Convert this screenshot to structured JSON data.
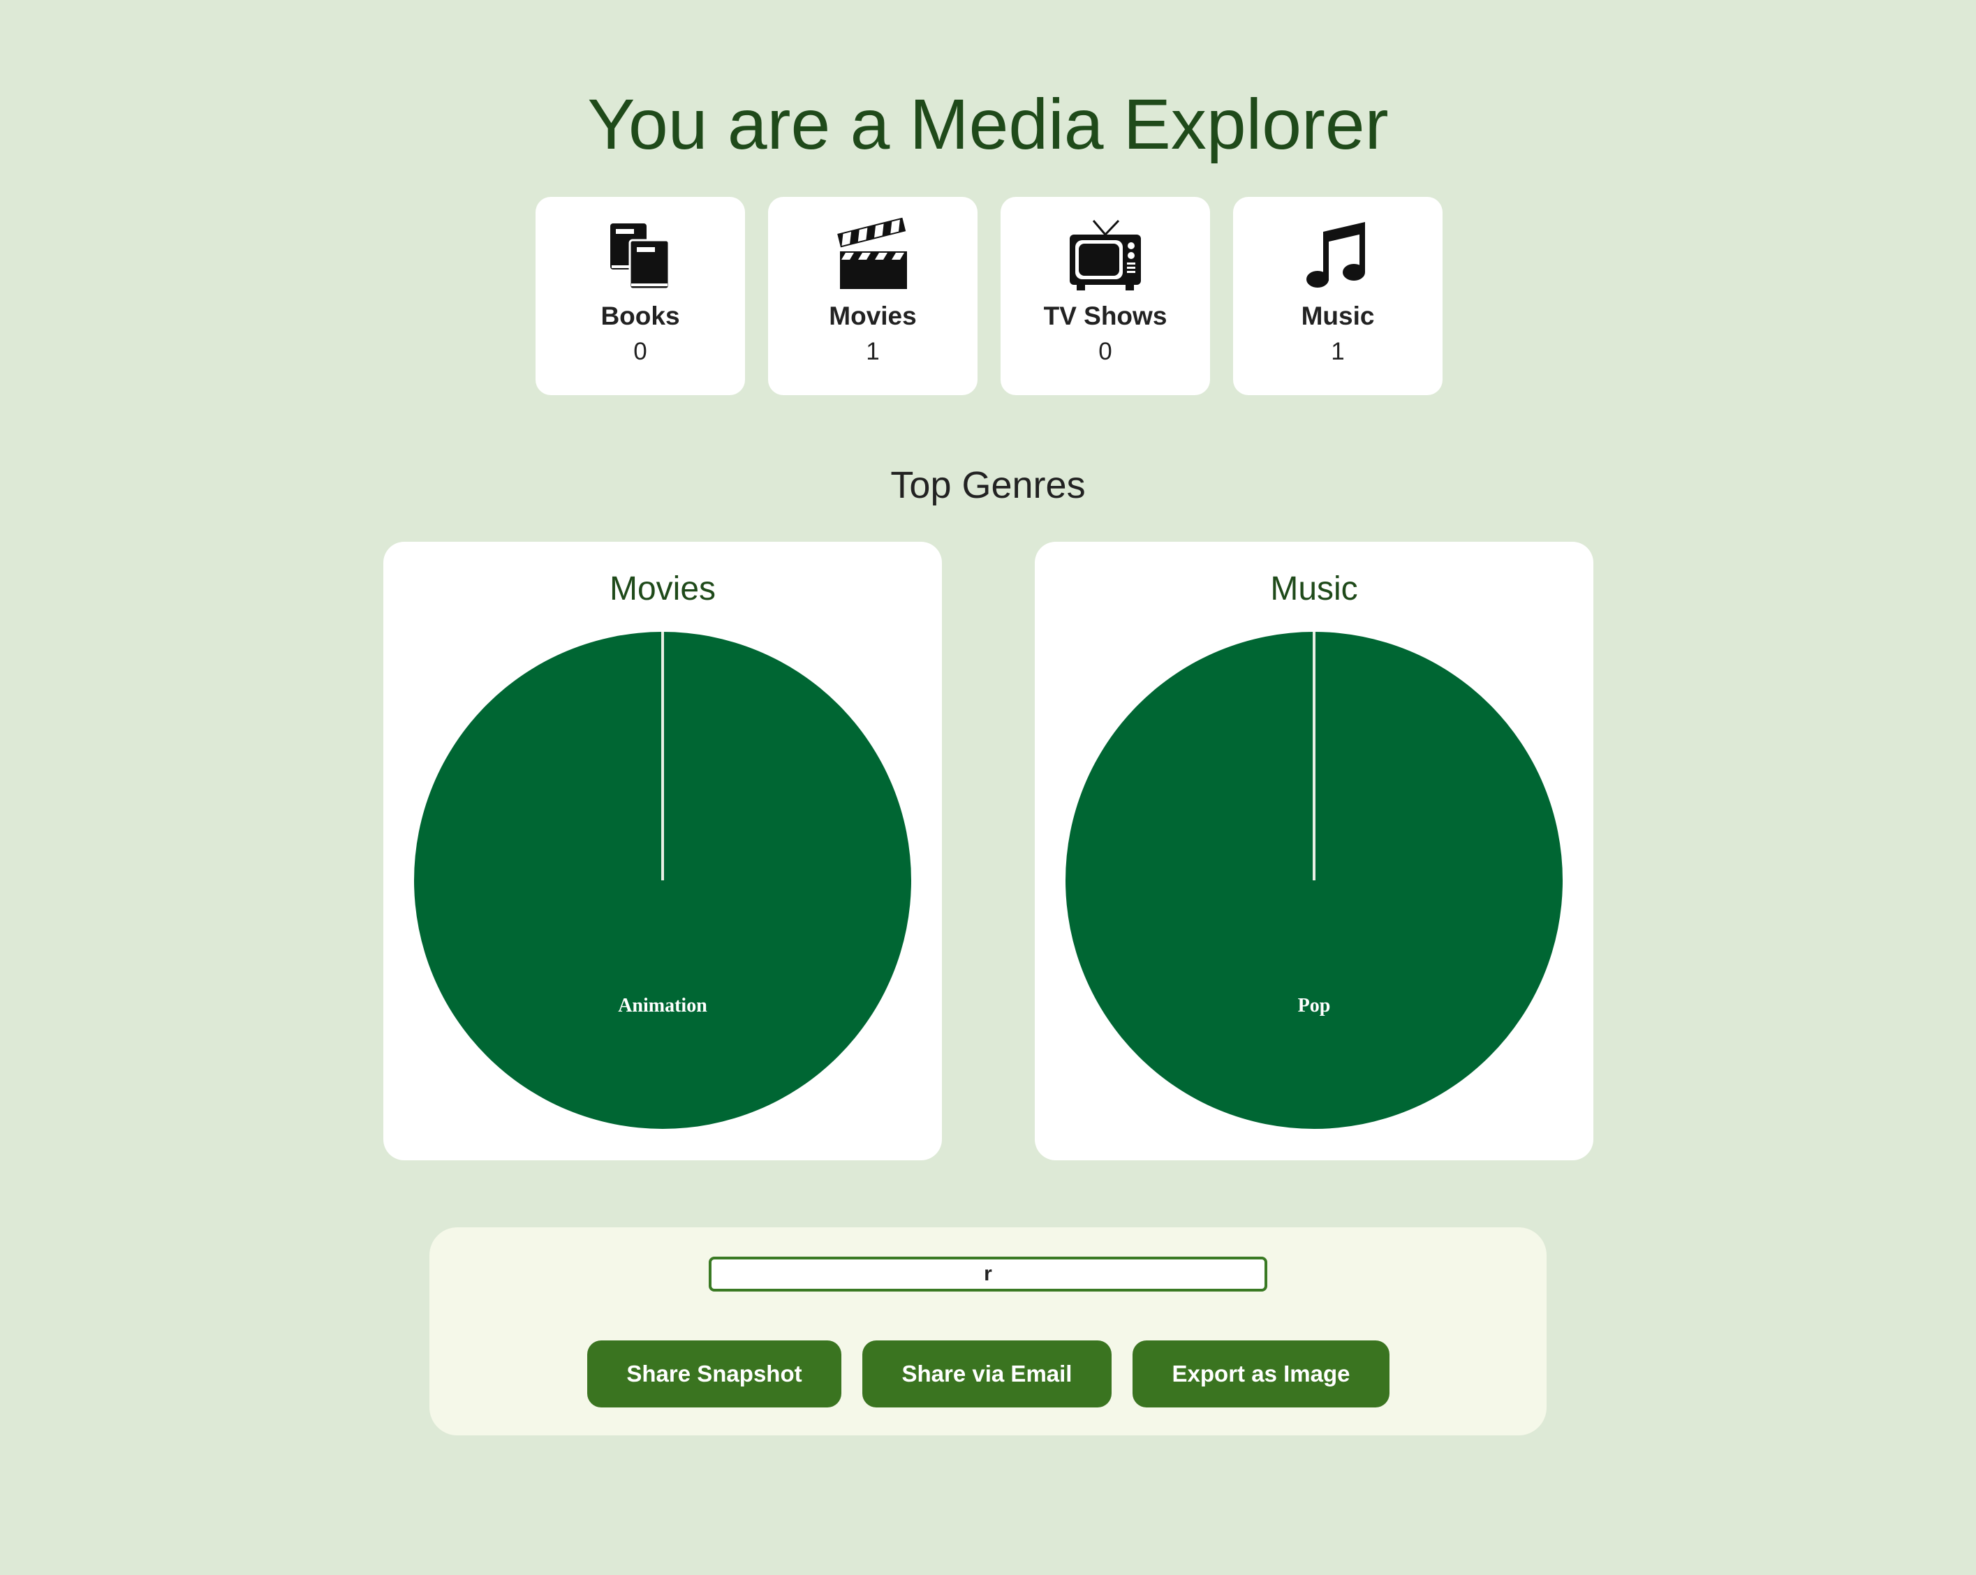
{
  "header": {
    "title": "You are a Media Explorer"
  },
  "stats": [
    {
      "label": "Books",
      "count": "0",
      "icon": "books-icon"
    },
    {
      "label": "Movies",
      "count": "1",
      "icon": "clapperboard-icon"
    },
    {
      "label": "TV Shows",
      "count": "0",
      "icon": "television-icon"
    },
    {
      "label": "Music",
      "count": "1",
      "icon": "music-note-icon"
    }
  ],
  "genres": {
    "heading": "Top Genres"
  },
  "chart_data": [
    {
      "type": "pie",
      "title": "Movies",
      "categories": [
        "Animation"
      ],
      "values": [
        1
      ],
      "colors": [
        "#006633"
      ]
    },
    {
      "type": "pie",
      "title": "Music",
      "categories": [
        "Pop"
      ],
      "values": [
        1
      ],
      "colors": [
        "#006633"
      ]
    }
  ],
  "share": {
    "input_value": "r",
    "buttons": {
      "snapshot": "Share Snapshot",
      "email": "Share via Email",
      "export": "Export as Image"
    }
  },
  "colors": {
    "background": "#dde9d6",
    "accent": "#3a7420",
    "pie": "#006633",
    "title": "#1f4a1a"
  }
}
